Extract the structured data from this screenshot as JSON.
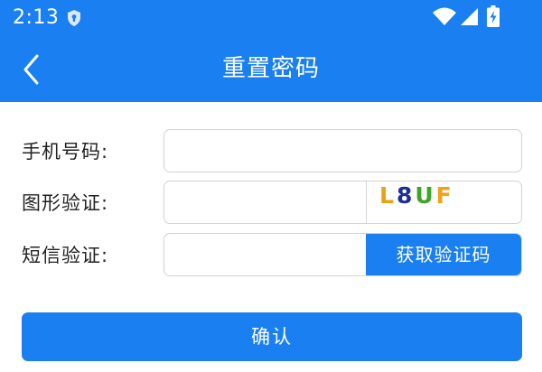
{
  "status_bar": {
    "time": "2:13",
    "icons": [
      "shield-icon",
      "wifi-icon",
      "signal-icon",
      "battery-charging-icon"
    ]
  },
  "header": {
    "title": "重置密码",
    "back_icon": "chevron-left-icon"
  },
  "form": {
    "phone": {
      "label": "手机号码:",
      "value": "",
      "placeholder": ""
    },
    "captcha": {
      "label": "图形验证:",
      "value": "",
      "placeholder": "",
      "code_chars": [
        "L",
        "8",
        "U",
        "F"
      ],
      "code_colors": [
        "#e8a21a",
        "#1d2e9a",
        "#3da626",
        "#f2a218"
      ]
    },
    "sms": {
      "label": "短信验证:",
      "value": "",
      "placeholder": "",
      "button_label": "获取验证码"
    }
  },
  "confirm_label": "确认",
  "colors": {
    "primary": "#1a7ff0",
    "text": "#222222",
    "border": "#d3d3d3",
    "background": "#ffffff"
  }
}
